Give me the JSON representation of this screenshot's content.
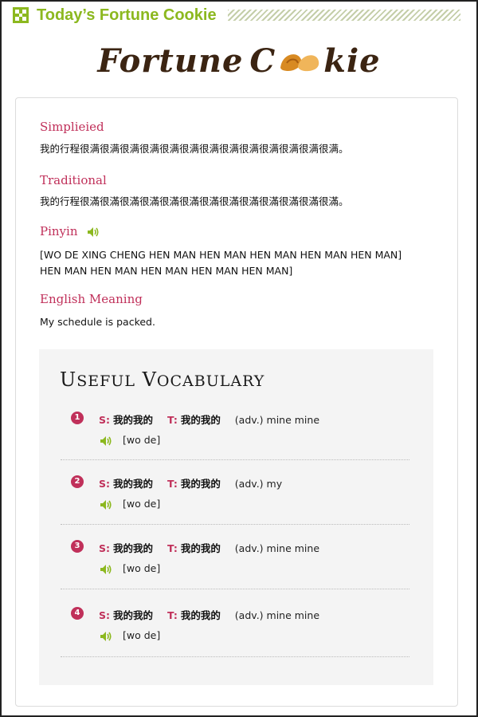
{
  "header": {
    "title": "Today’s Fortune Cookie"
  },
  "brand": {
    "left": "Fortune",
    "o": "o",
    "right": "kie"
  },
  "sections": {
    "simplified": {
      "title": "Simplieied",
      "text": "我的行程很满很满很满很满很满很满很满很满很满很满很满很满很满。"
    },
    "traditional": {
      "title": "Traditional",
      "text": "我的行程很滿很滿很滿很滿很滿很滿很滿很滿很滿很滿很滿很滿很滿。"
    },
    "pinyin": {
      "title": "Pinyin",
      "line1": "[WO DE XING CHENG HEN MAN HEN MAN HEN MAN HEN MAN HEN MAN]",
      "line2": "HEN MAN HEN MAN HEN MAN HEN MAN HEN MAN]"
    },
    "english": {
      "title": "English Meaning",
      "text": "My schedule is packed."
    }
  },
  "vocabulary": {
    "title": "Useful Vocabulary",
    "s_label": "S:",
    "t_label": "T:",
    "items": [
      {
        "num": "1",
        "simplified": "我的我的",
        "traditional": "我的我的",
        "definition": "(adv.) mine mine",
        "pinyin": "[wo de]"
      },
      {
        "num": "2",
        "simplified": "我的我的",
        "traditional": "我的我的",
        "definition": "(adv.) my",
        "pinyin": "[wo de]"
      },
      {
        "num": "3",
        "simplified": "我的我的",
        "traditional": "我的我的",
        "definition": "(adv.) mine mine",
        "pinyin": "[wo de]"
      },
      {
        "num": "4",
        "simplified": "我的我的",
        "traditional": "我的我的",
        "definition": "(adv.) mine mine",
        "pinyin": "[wo de]"
      }
    ]
  },
  "colors": {
    "accent_green": "#8cb81f",
    "accent_red": "#c0305a",
    "vocab_bg": "#f4f4f4"
  }
}
